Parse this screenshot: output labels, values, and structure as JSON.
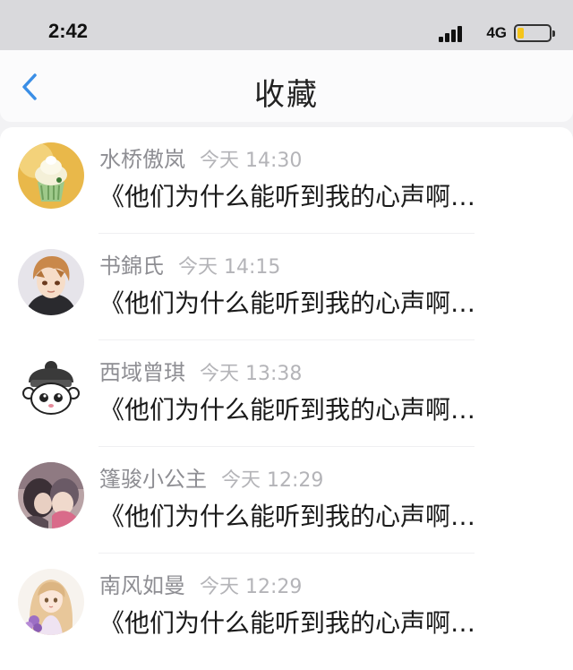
{
  "status_bar": {
    "time": "2:42",
    "network": "4G",
    "battery_level": 0.2,
    "battery_color": "#f5c51b"
  },
  "nav": {
    "back_icon": "chevron-left-icon",
    "title": "收藏",
    "accent_color": "#3a8ee6"
  },
  "items": [
    {
      "name": "水桥傲岚",
      "time": "今天 14:30",
      "message": "《他们为什么能听到我的心声啊…",
      "avatar": "cupcake-avatar"
    },
    {
      "name": "书錦氏",
      "time": "今天 14:15",
      "message": "《他们为什么能听到我的心声啊…",
      "avatar": "anime-boy-avatar"
    },
    {
      "name": "西域曾琪",
      "time": "今天 13:38",
      "message": "《他们为什么能听到我的心声啊…",
      "avatar": "cartoon-mouse-avatar"
    },
    {
      "name": "篷骏小公主",
      "time": "今天 12:29",
      "message": "《他们为什么能听到我的心声啊…",
      "avatar": "photo-avatar"
    },
    {
      "name": "南风如曼",
      "time": "今天 12:29",
      "message": "《他们为什么能听到我的心声啊…",
      "avatar": "anime-girl-avatar"
    }
  ]
}
